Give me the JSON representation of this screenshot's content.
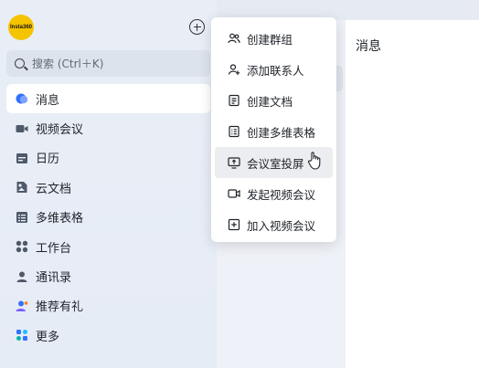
{
  "app": {
    "logo_text": "Insta360"
  },
  "search": {
    "placeholder": "搜索 (Ctrl＋K)"
  },
  "sidebar": {
    "items": [
      {
        "label": "消息",
        "icon": "message-icon"
      },
      {
        "label": "视频会议",
        "icon": "video-camera-icon"
      },
      {
        "label": "日历",
        "icon": "calendar-icon"
      },
      {
        "label": "云文档",
        "icon": "cloud-doc-icon"
      },
      {
        "label": "多维表格",
        "icon": "table-icon"
      },
      {
        "label": "工作台",
        "icon": "workspace-grid-icon"
      },
      {
        "label": "通讯录",
        "icon": "contacts-icon"
      },
      {
        "label": "推荐有礼",
        "icon": "referral-gift-icon"
      },
      {
        "label": "更多",
        "icon": "more-apps-icon"
      }
    ]
  },
  "content": {
    "title": "消息"
  },
  "menu": {
    "items": [
      {
        "label": "创建群组",
        "icon": "group-icon"
      },
      {
        "label": "添加联系人",
        "icon": "add-contact-icon"
      },
      {
        "label": "创建文档",
        "icon": "document-icon"
      },
      {
        "label": "创建多维表格",
        "icon": "table-icon"
      },
      {
        "label": "会议室投屏",
        "icon": "screen-cast-icon"
      },
      {
        "label": "发起视频会议",
        "icon": "video-icon"
      },
      {
        "label": "加入视频会议",
        "icon": "join-icon"
      }
    ]
  },
  "colors": {
    "accent": "#3370ff",
    "logo_bg": "#f5c400"
  }
}
